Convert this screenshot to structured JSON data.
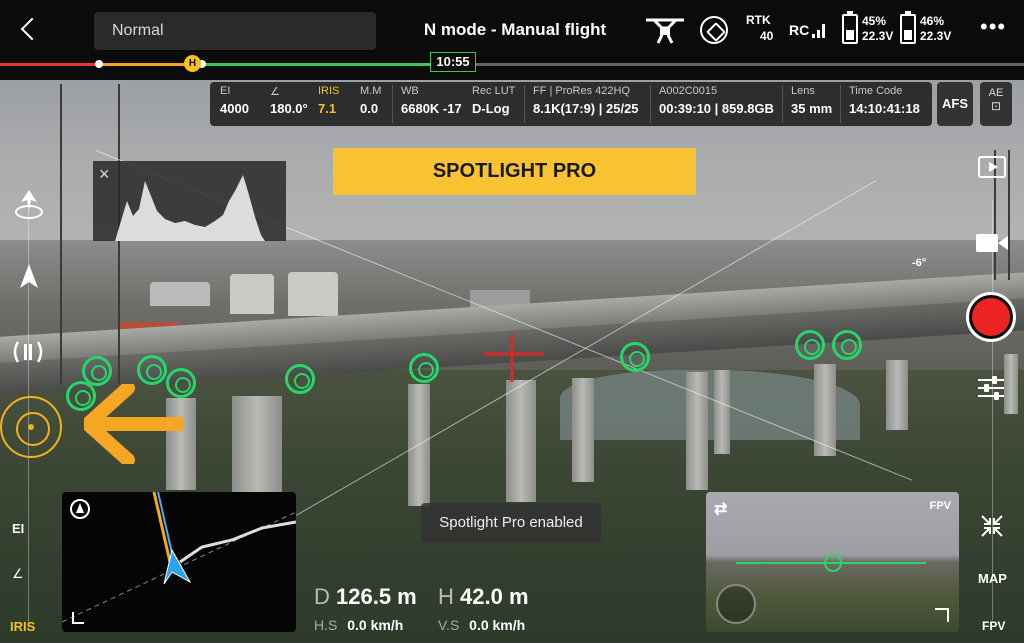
{
  "header": {
    "back_icon": "back-chevron-icon",
    "mode_select_value": "Normal",
    "title": "N mode - Manual flight",
    "rtk_label": "RTK",
    "rtk_count": "40",
    "rc_label": "RC",
    "battery_left": {
      "percent": "45%",
      "voltage": "22.3V"
    },
    "battery_right": {
      "percent": "46%",
      "voltage": "22.3V"
    },
    "menu_icon": "more-dots-icon"
  },
  "timeline": {
    "home_label": "H",
    "flight_time": "10:55"
  },
  "camera_params": {
    "items": [
      {
        "key": "EI",
        "value": "4000"
      },
      {
        "key": "",
        "value": "180.0°"
      },
      {
        "key": "IRIS",
        "value": "7.1"
      },
      {
        "key": "M.M",
        "value": "0.0"
      },
      {
        "key": "WB",
        "value": "6680K -17"
      },
      {
        "key": "Rec LUT",
        "value": "D-Log"
      },
      {
        "key": "FF | ProRes 422HQ",
        "value": "8.1K(17:9) | 25/25"
      },
      {
        "key": "A002C0015",
        "value": "00:39:10 | 859.8GB"
      },
      {
        "key": "Lens",
        "value": "35 mm"
      },
      {
        "key": "Time Code",
        "value": "14:10:41:18"
      }
    ],
    "afs_label": "AFS",
    "ae_label": "AE",
    "accent": "#f2c21b"
  },
  "banner": {
    "text": "SPOTLIGHT PRO",
    "color": "#f9c230"
  },
  "right_controls": {
    "gimbal_angle": "-6°"
  },
  "left_controls": {
    "ei_label": "EI",
    "iris_label": "IRIS"
  },
  "toast": {
    "text": "Spotlight Pro enabled"
  },
  "telemetry": {
    "distance_label": "D",
    "distance_value": "126.5 m",
    "height_label": "H",
    "height_value": "42.0 m",
    "hs_label": "H.S",
    "hs_value": "0.0 km/h",
    "vs_label": "V.S",
    "vs_value": "0.0 km/h"
  },
  "fpv_window": {
    "label": "FPV",
    "swap_icon": "swap-arrows-icon"
  },
  "bottom_right": {
    "map_label": "MAP",
    "fpv_label": "FPV"
  },
  "colors": {
    "marker": "#26d66a",
    "record": "#ec2424",
    "target": "#f2b21a"
  }
}
